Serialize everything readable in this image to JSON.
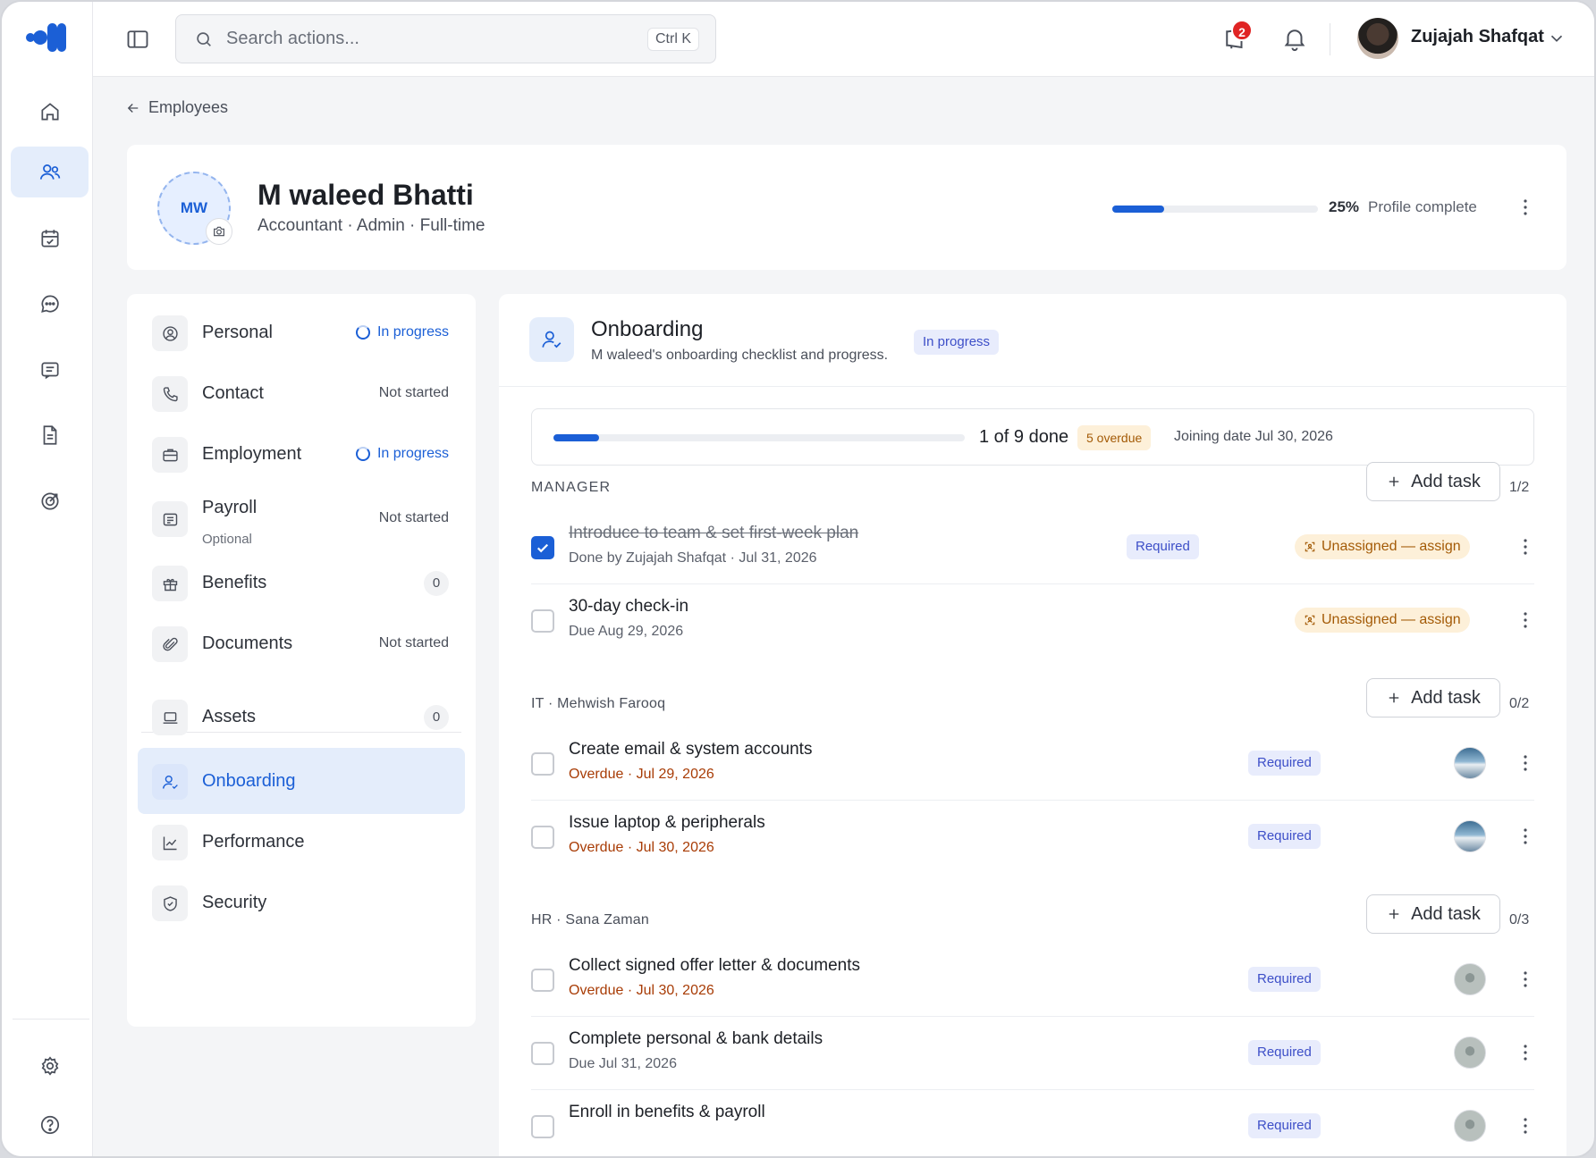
{
  "header": {
    "search_placeholder": "Search actions...",
    "search_shortcut": "Ctrl K",
    "notification_count": "2",
    "user_name": "Zujajah Shafqat"
  },
  "breadcrumb": {
    "back_label": "Employees"
  },
  "profile": {
    "initials": "MW",
    "name": "M waleed Bhatti",
    "subtitle": "Accountant · Admin · Full-time",
    "completion_percent": "25%",
    "completion_value": 25,
    "completion_label": "Profile complete"
  },
  "sections": [
    {
      "label": "Personal",
      "status": "In progress",
      "status_type": "progress",
      "icon": "user-circle-icon"
    },
    {
      "label": "Contact",
      "status": "Not started",
      "status_type": "text",
      "icon": "phone-icon"
    },
    {
      "label": "Employment",
      "status": "In progress",
      "status_type": "progress",
      "icon": "briefcase-icon"
    },
    {
      "label": "Payroll",
      "sublabel": "Optional",
      "status": "Not started",
      "status_type": "text",
      "icon": "receipt-icon"
    },
    {
      "label": "Benefits",
      "count": "0",
      "icon": "gift-icon"
    },
    {
      "label": "Documents",
      "status": "Not started",
      "status_type": "text",
      "icon": "paperclip-icon"
    },
    {
      "label": "Assets",
      "count": "0",
      "icon": "laptop-icon"
    },
    {
      "label": "Onboarding",
      "icon": "user-check-icon",
      "active": true
    },
    {
      "label": "Performance",
      "icon": "chart-line-icon"
    },
    {
      "label": "Security",
      "icon": "shield-icon"
    }
  ],
  "onboarding": {
    "title": "Onboarding",
    "subtitle": "M waleed's onboarding checklist and progress.",
    "status": "In progress",
    "progress_value": 0.111,
    "progress_text": "1 of 9 done",
    "overdue_badge": "5 overdue",
    "joining": "Joining date Jul 30, 2026",
    "add_task_label": "Add task",
    "groups": [
      {
        "title": "MANAGER",
        "count": "1/2",
        "tasks": [
          {
            "title": "Introduce to team & set first-week plan",
            "meta": "Done by Zujajah Shafqat · Jul 31, 2026",
            "done": true,
            "required": "Required",
            "assign": "Unassigned — assign"
          },
          {
            "title": "30-day check-in",
            "meta": "Due Aug 29, 2026",
            "done": false,
            "assign": "Unassigned — assign"
          }
        ]
      },
      {
        "title": "IT · Mehwish Farooq",
        "count": "0/2",
        "tasks": [
          {
            "title": "Create email & system accounts",
            "meta": "Overdue · Jul 29, 2026",
            "overdue": true,
            "required": "Required"
          },
          {
            "title": "Issue laptop & peripherals",
            "meta": "Overdue · Jul 30, 2026",
            "overdue": true,
            "required": "Required"
          }
        ]
      },
      {
        "title": "HR · Sana Zaman",
        "count": "0/3",
        "tasks": [
          {
            "title": "Collect signed offer letter & documents",
            "meta": "Overdue · Jul 30, 2026",
            "overdue": true,
            "required": "Required"
          },
          {
            "title": "Complete personal & bank details",
            "meta": "Due Jul 31, 2026",
            "required": "Required"
          },
          {
            "title": "Enroll in benefits & payroll",
            "meta": "",
            "required": "Required"
          }
        ]
      }
    ]
  },
  "colors": {
    "accent": "#1b5fd6",
    "overdue": "#a83c06",
    "warning_bg": "#fdf0d9"
  }
}
